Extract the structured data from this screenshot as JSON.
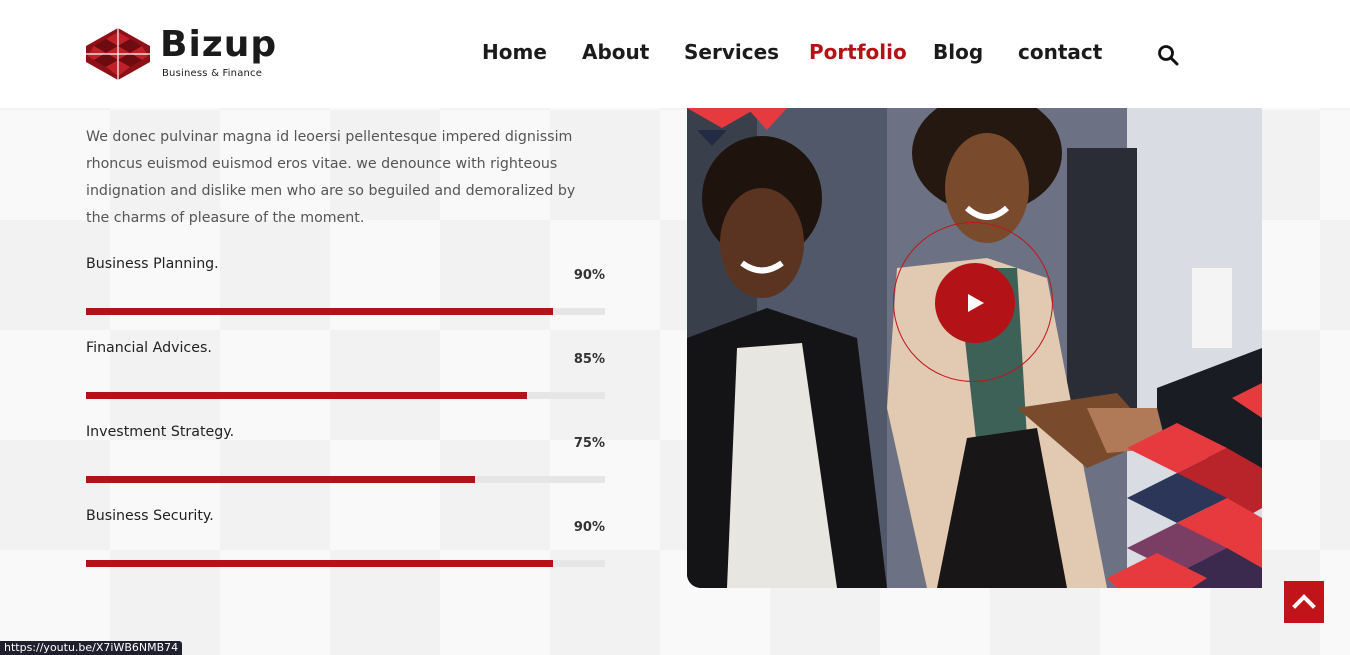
{
  "brand": {
    "name": "Bizup",
    "tagline": "Business & Finance",
    "accent": "#b31217"
  },
  "nav": {
    "items": [
      {
        "label": "Home",
        "active": false
      },
      {
        "label": "About",
        "active": false
      },
      {
        "label": "Services",
        "active": false
      },
      {
        "label": "Portfolio",
        "active": true
      },
      {
        "label": "Blog",
        "active": false
      },
      {
        "label": "contact",
        "active": false
      }
    ],
    "search_icon": "search-icon"
  },
  "intro": {
    "lines": [
      "We donec pulvinar magna id leoersi pellentesque impered dignissim",
      "rhoncus euismod euismod eros vitae. we denounce with righteous",
      "indignation and dislike men who are so beguiled and demoralized by",
      "the charms of pleasure of the moment."
    ]
  },
  "skills": [
    {
      "label": "Business Planning.",
      "percent_text": "90%",
      "value": 0.9
    },
    {
      "label": "Financial Advices.",
      "percent_text": "85%",
      "value": 0.85
    },
    {
      "label": "Investment Strategy.",
      "percent_text": "75%",
      "value": 0.75
    },
    {
      "label": "Business Security.",
      "percent_text": "90%",
      "value": 0.9
    }
  ],
  "media": {
    "play_icon": "play-icon"
  },
  "scroll_top_icon": "chevron-up-icon",
  "status_bar": {
    "url": "https://youtu.be/X7iWB6NMB74"
  }
}
